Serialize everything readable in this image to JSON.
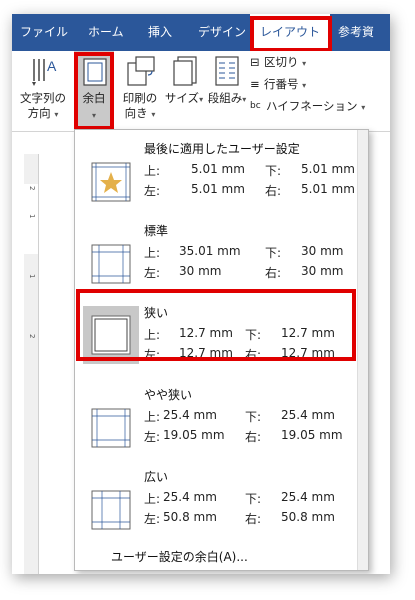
{
  "tabs": [
    {
      "label": "ファイル"
    },
    {
      "label": "ホーム"
    },
    {
      "label": "挿入"
    },
    {
      "label": "デザイン"
    },
    {
      "label": "レイアウト"
    },
    {
      "label": "参考資"
    }
  ],
  "ribbon": {
    "text_direction": {
      "line1": "文字列の",
      "line2": "方向"
    },
    "margins": {
      "label": "余白"
    },
    "orientation": {
      "line1": "印刷の",
      "line2": "向き"
    },
    "size": {
      "label": "サイズ"
    },
    "columns": {
      "label": "段組み"
    },
    "breaks": {
      "label": "区切り"
    },
    "line_numbers": {
      "label": "行番号"
    },
    "hyphenation": {
      "label": "ハイフネーション"
    }
  },
  "ruler": {
    "ticks": [
      "2",
      "1",
      "1",
      "2"
    ]
  },
  "margins_menu": {
    "presets": [
      {
        "name": "最後に適用したユーザー設定",
        "icon": "star-margin-icon",
        "top_label": "上:",
        "top": "5.01 mm",
        "bottom_label": "下:",
        "bottom": "5.01 mm",
        "left_label": "左:",
        "left": "5.01 mm",
        "right_label": "右:",
        "right": "5.01 mm"
      },
      {
        "name": "標準",
        "icon": "normal-margin-icon",
        "top_label": "上:",
        "top": "35.01 mm",
        "bottom_label": "下:",
        "bottom": "30 mm",
        "left_label": "左:",
        "left": "30 mm",
        "right_label": "右:",
        "right": "30 mm"
      },
      {
        "name": "狭い",
        "icon": "narrow-margin-icon",
        "top_label": "上:",
        "top": "12.7 mm",
        "bottom_label": "下:",
        "bottom": "12.7 mm",
        "left_label": "左:",
        "left": "12.7 mm",
        "right_label": "右:",
        "right": "12.7 mm"
      },
      {
        "name": "やや狭い",
        "icon": "moderate-margin-icon",
        "top_label": "上:",
        "top": "25.4 mm",
        "bottom_label": "下:",
        "bottom": "25.4 mm",
        "left_label": "左:",
        "left": "19.05 mm",
        "right_label": "右:",
        "right": "19.05 mm"
      },
      {
        "name": "広い",
        "icon": "wide-margin-icon",
        "top_label": "上:",
        "top": "25.4 mm",
        "bottom_label": "下:",
        "bottom": "25.4 mm",
        "left_label": "左:",
        "left": "50.8 mm",
        "right_label": "右:",
        "right": "50.8 mm"
      }
    ],
    "custom_label": "ユーザー設定の余白(A)..."
  },
  "colors": {
    "ribbon_blue": "#2b579a",
    "highlight_red": "#e00000",
    "selected_gray": "#c8c8c8"
  }
}
